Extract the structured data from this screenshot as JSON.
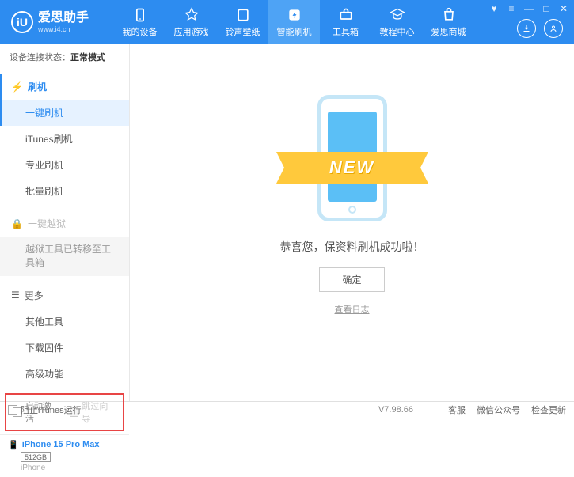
{
  "app": {
    "name": "爱思助手",
    "url": "www.i4.cn",
    "logo_letter": "iU"
  },
  "nav": [
    {
      "label": "我的设备"
    },
    {
      "label": "应用游戏"
    },
    {
      "label": "铃声壁纸"
    },
    {
      "label": "智能刷机"
    },
    {
      "label": "工具箱"
    },
    {
      "label": "教程中心"
    },
    {
      "label": "爱思商城"
    }
  ],
  "device_status": {
    "label": "设备连接状态：",
    "value": "正常模式"
  },
  "sidebar": {
    "flash": {
      "head": "刷机",
      "items": [
        "一键刷机",
        "iTunes刷机",
        "专业刷机",
        "批量刷机"
      ]
    },
    "jailbreak": {
      "head": "一键越狱",
      "note": "越狱工具已转移至工具箱"
    },
    "more": {
      "head": "更多",
      "items": [
        "其他工具",
        "下载固件",
        "高级功能"
      ]
    },
    "checkboxes": {
      "auto_activate": "自动激活",
      "skip_guide": "跳过向导"
    }
  },
  "device": {
    "name": "iPhone 15 Pro Max",
    "storage": "512GB",
    "type": "iPhone"
  },
  "main": {
    "new_label": "NEW",
    "success_text": "恭喜您，保资料刷机成功啦！",
    "ok_button": "确定",
    "log_link": "查看日志"
  },
  "footer": {
    "block_itunes": "阻止iTunes运行",
    "version": "V7.98.66",
    "items": [
      "客服",
      "微信公众号",
      "检查更新"
    ]
  }
}
